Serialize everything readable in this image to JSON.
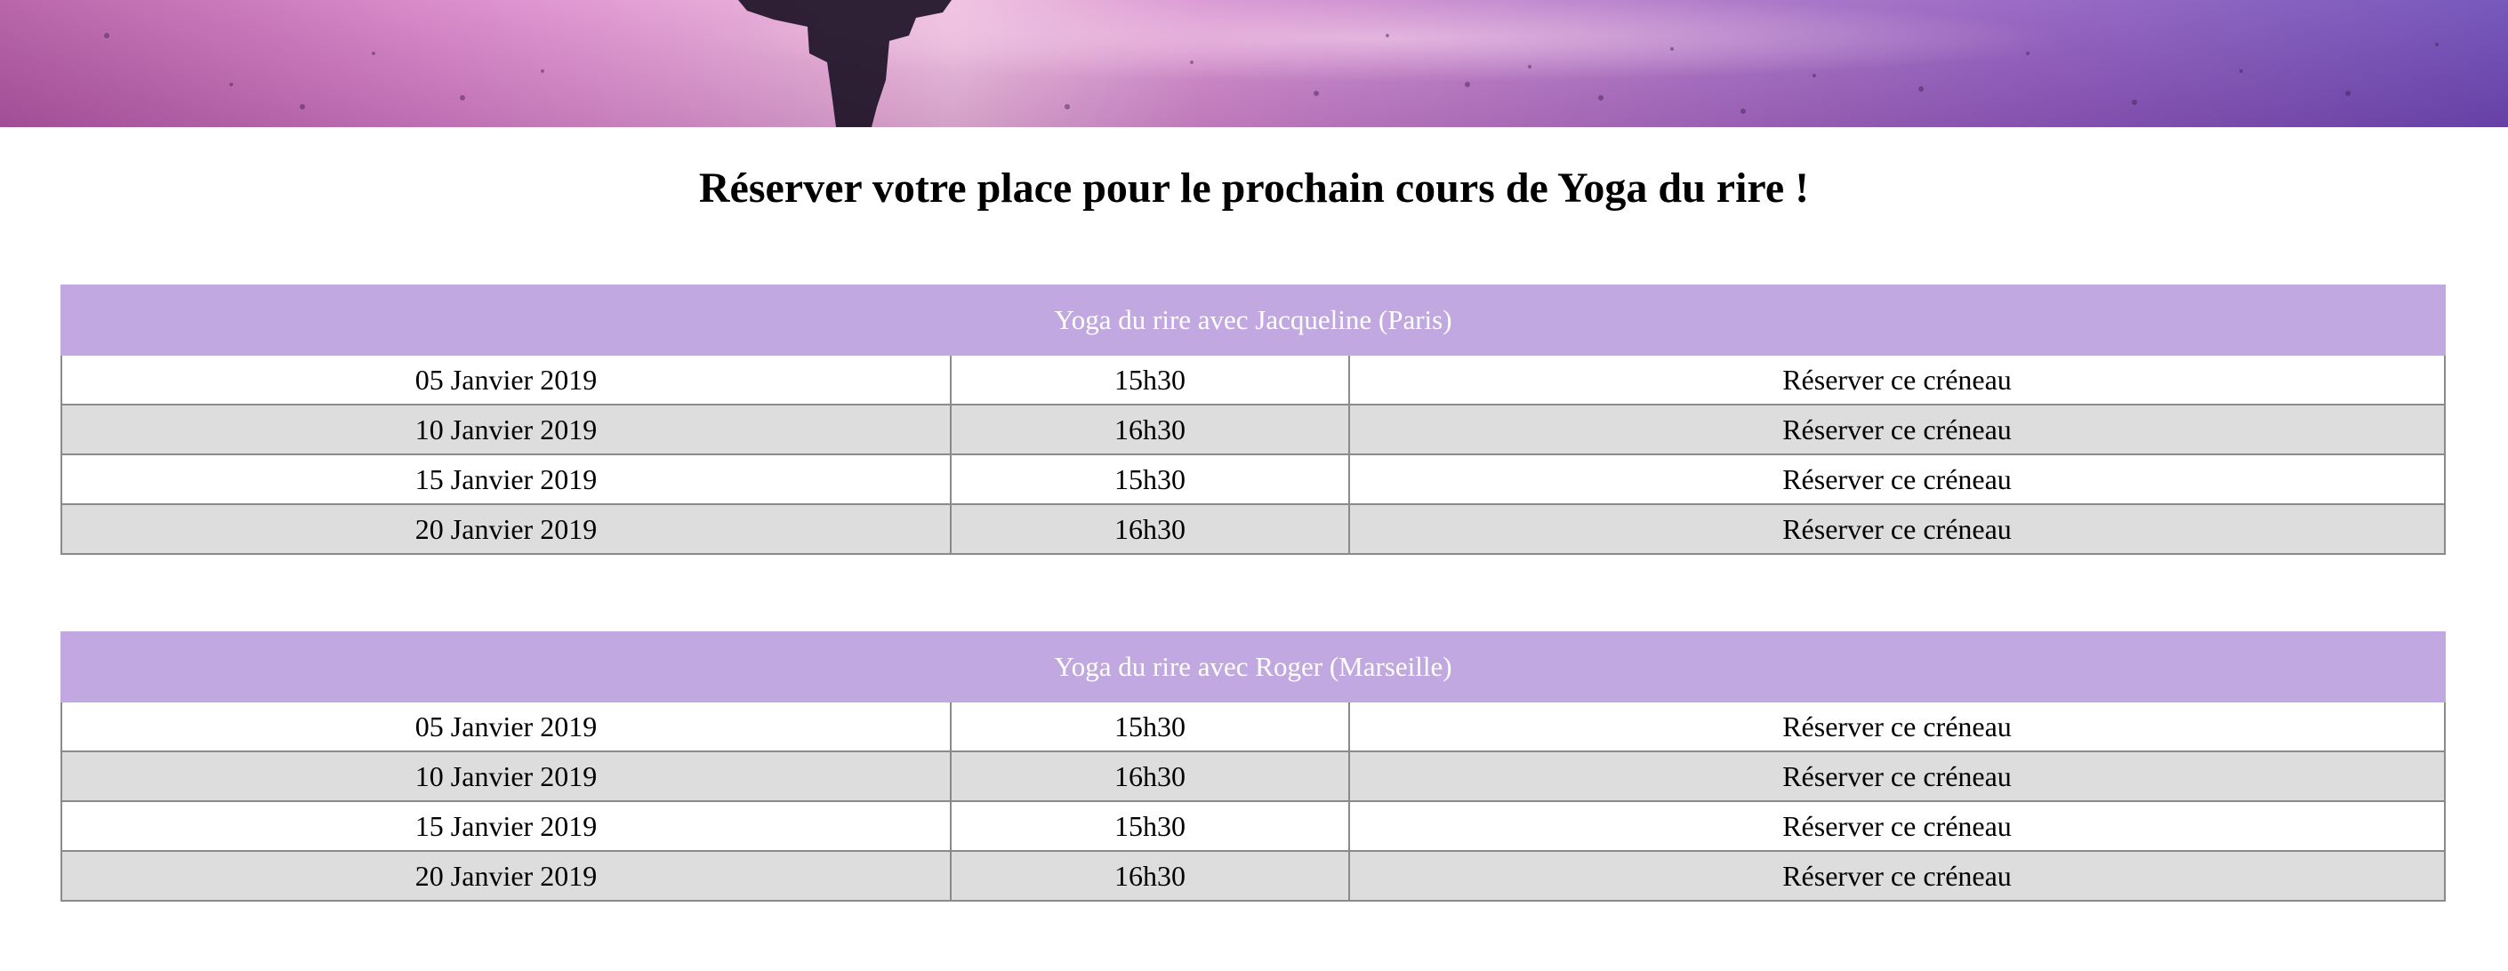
{
  "page": {
    "title": "Réserver votre place pour le prochain cours de Yoga du rire !"
  },
  "colors": {
    "header_background": "#c2a8e0",
    "header_text": "#ffffff",
    "row_alternate": "#dddddd",
    "border": "#8a8a8a"
  },
  "tables": [
    {
      "heading": "Yoga du rire avec Jacqueline (Paris)",
      "rows": [
        {
          "date": "05 Janvier 2019",
          "time": "15h30",
          "action": "Réserver ce créneau"
        },
        {
          "date": "10 Janvier 2019",
          "time": "16h30",
          "action": "Réserver ce créneau"
        },
        {
          "date": "15 Janvier 2019",
          "time": "15h30",
          "action": "Réserver ce créneau"
        },
        {
          "date": "20 Janvier 2019",
          "time": "16h30",
          "action": "Réserver ce créneau"
        }
      ]
    },
    {
      "heading": "Yoga du rire avec Roger (Marseille)",
      "rows": [
        {
          "date": "05 Janvier 2019",
          "time": "15h30",
          "action": "Réserver ce créneau"
        },
        {
          "date": "10 Janvier 2019",
          "time": "16h30",
          "action": "Réserver ce créneau"
        },
        {
          "date": "15 Janvier 2019",
          "time": "15h30",
          "action": "Réserver ce créneau"
        },
        {
          "date": "20 Janvier 2019",
          "time": "16h30",
          "action": "Réserver ce créneau"
        }
      ]
    }
  ]
}
